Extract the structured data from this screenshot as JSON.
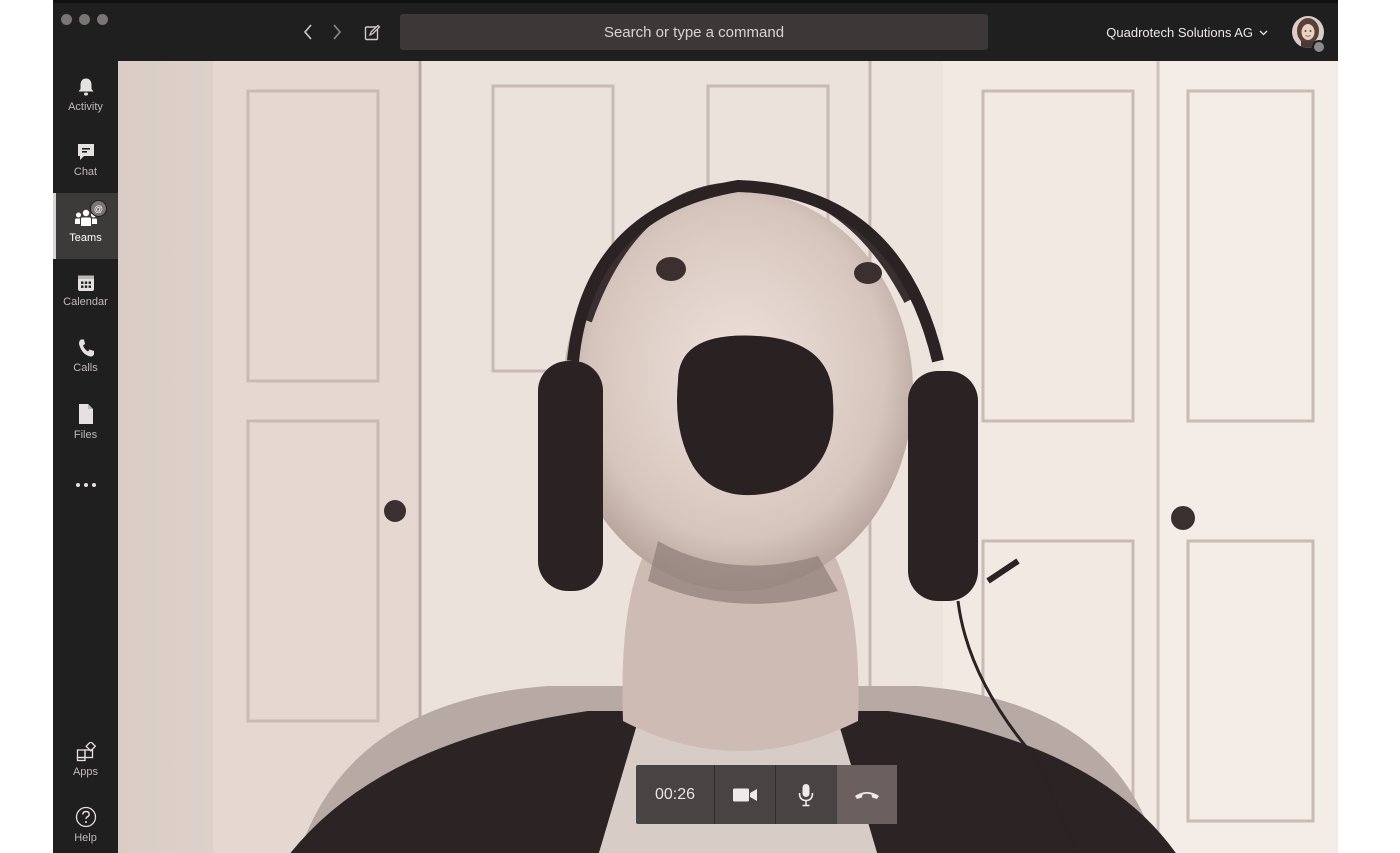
{
  "titlebar": {
    "search_placeholder": "Search or type a command",
    "org_name": "Quadrotech Solutions AG",
    "icons": [
      "back-arrow-icon",
      "forward-arrow-icon",
      "compose-icon",
      "chevron-down-icon"
    ]
  },
  "rail": {
    "items": [
      {
        "label": "Activity",
        "icon": "bell-icon"
      },
      {
        "label": "Chat",
        "icon": "chat-icon"
      },
      {
        "label": "Teams",
        "icon": "teams-icon",
        "active": true,
        "badge": "@"
      },
      {
        "label": "Calendar",
        "icon": "calendar-icon"
      },
      {
        "label": "Calls",
        "icon": "phone-icon"
      },
      {
        "label": "Files",
        "icon": "file-icon"
      },
      {
        "label": "Apps",
        "icon": "apps-icon"
      },
      {
        "label": "Help",
        "icon": "help-icon"
      }
    ]
  },
  "call": {
    "duration": "00:26",
    "controls": [
      "camera-icon",
      "microphone-icon",
      "hang-up-icon"
    ]
  },
  "colors": {
    "chrome": "#201f1f",
    "active_item": "#3d3a3a",
    "search_bg": "#3c3838",
    "controls_bg": "#3c3838",
    "hangup_bg": "#6b5f60"
  }
}
